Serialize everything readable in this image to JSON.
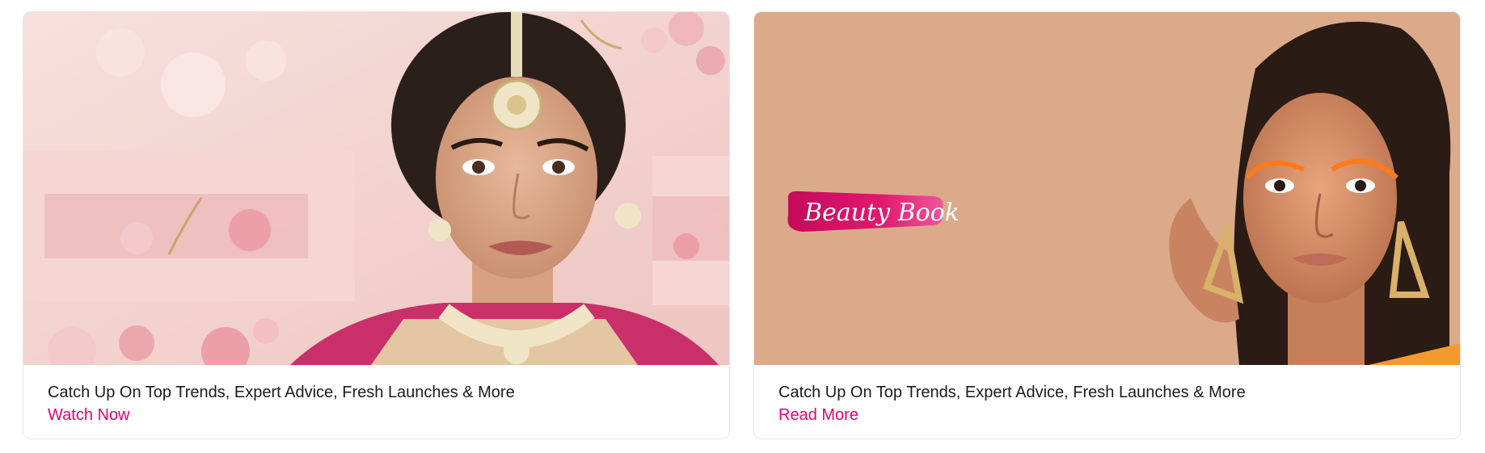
{
  "cards": [
    {
      "title": "Catch Up On Top Trends, Expert Advice, Fresh Launches & More",
      "link_label": "Watch Now",
      "theme": {
        "background": "#f3d3d0",
        "accent": "#e80071"
      }
    },
    {
      "title": "Catch Up On Top Trends, Expert Advice, Fresh Launches & More",
      "link_label": "Read More",
      "banner_logo": "Beauty Book",
      "theme": {
        "background": "#dbaa8b",
        "accent": "#e80071"
      }
    }
  ],
  "colors": {
    "text": "#1b1b1b",
    "link": "#e80071",
    "border": "#e5e5e5"
  }
}
